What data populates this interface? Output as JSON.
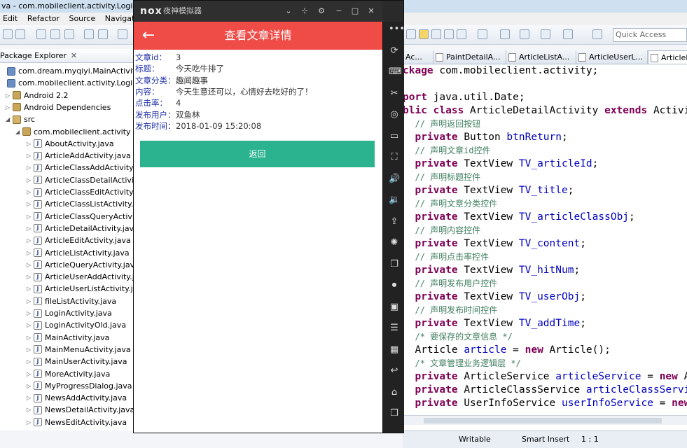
{
  "ide": {
    "window_title": "va - com.mobileclient.activity.LoginAct",
    "menu": [
      "Edit",
      "Refactor",
      "Source",
      "Navigate"
    ],
    "quick_access_placeholder": "Quick Access",
    "package_explorer": {
      "title": "Package Explorer",
      "items": [
        {
          "label": "com.dream.myqiyi.MainActivity",
          "kind": "proj"
        },
        {
          "label": "com.mobileclient.activity.LoginActiv",
          "kind": "proj"
        },
        {
          "label": "Android 2.2",
          "kind": "lib"
        },
        {
          "label": "Android Dependencies",
          "kind": "lib"
        },
        {
          "label": "src",
          "kind": "src"
        },
        {
          "label": "com.mobileclient.activity",
          "kind": "pkg"
        },
        {
          "label": "AboutActivity.java",
          "kind": "java"
        },
        {
          "label": "ArticleAddActivity.java",
          "kind": "java"
        },
        {
          "label": "ArticleClassAddActivity.ja",
          "kind": "java"
        },
        {
          "label": "ArticleClassDetailActivity.",
          "kind": "java"
        },
        {
          "label": "ArticleClassEditActivity.jav",
          "kind": "java"
        },
        {
          "label": "ArticleClassListActivity.jav",
          "kind": "java"
        },
        {
          "label": "ArticleClassQueryActivity.j",
          "kind": "java"
        },
        {
          "label": "ArticleDetailActivity.java",
          "kind": "java"
        },
        {
          "label": "ArticleEditActivity.java",
          "kind": "java"
        },
        {
          "label": "ArticleListActivity.java",
          "kind": "java"
        },
        {
          "label": "ArticleQueryActivity.java",
          "kind": "java"
        },
        {
          "label": "ArticleUserAddActivity.jav",
          "kind": "java"
        },
        {
          "label": "ArticleUserListActivity.jav",
          "kind": "java"
        },
        {
          "label": "fileListActivity.java",
          "kind": "java"
        },
        {
          "label": "LoginActivity.java",
          "kind": "java"
        },
        {
          "label": "LoginActivityOld.java",
          "kind": "java"
        },
        {
          "label": "MainActivity.java",
          "kind": "java"
        },
        {
          "label": "MainMenuActivity.java",
          "kind": "java"
        },
        {
          "label": "MainUserActivity.java",
          "kind": "java"
        },
        {
          "label": "MoreActivity.java",
          "kind": "java"
        },
        {
          "label": "MyProgressDialog.java",
          "kind": "java"
        },
        {
          "label": "NewsAddActivity.java",
          "kind": "java"
        },
        {
          "label": "NewsDetailActivity.java",
          "kind": "java"
        },
        {
          "label": "NewsEditActivity.java",
          "kind": "java"
        }
      ]
    },
    "editor_tabs": [
      "Ac...",
      "PaintDetailA...",
      "ArticleListA...",
      "ArticleUserL...",
      "ArticleD"
    ],
    "code_lines": [
      [
        {
          "t": "kw",
          "s": "ckage "
        },
        {
          "t": "",
          "s": "com.mobileclient.activity;"
        }
      ],
      [
        {
          "t": "",
          "s": ""
        }
      ],
      [
        {
          "t": "kw",
          "s": "port "
        },
        {
          "t": "",
          "s": "java.util.Date;"
        }
      ],
      [
        {
          "t": "kw",
          "s": "blic class "
        },
        {
          "t": "",
          "s": "ArticleDetailActivity "
        },
        {
          "t": "kw",
          "s": "extends "
        },
        {
          "t": "",
          "s": "Activit"
        }
      ],
      [
        {
          "t": "",
          "s": "  "
        },
        {
          "t": "cm",
          "s": "// 声明返回按钮"
        }
      ],
      [
        {
          "t": "",
          "s": "  "
        },
        {
          "t": "kw",
          "s": "private "
        },
        {
          "t": "",
          "s": "Button "
        },
        {
          "t": "fd",
          "s": "btnReturn"
        },
        {
          "t": "",
          "s": ";"
        }
      ],
      [
        {
          "t": "",
          "s": "  "
        },
        {
          "t": "cm",
          "s": "// 声明文章id控件"
        }
      ],
      [
        {
          "t": "",
          "s": "  "
        },
        {
          "t": "kw",
          "s": "private "
        },
        {
          "t": "",
          "s": "TextView "
        },
        {
          "t": "fd",
          "s": "TV_articleId"
        },
        {
          "t": "",
          "s": ";"
        }
      ],
      [
        {
          "t": "",
          "s": "  "
        },
        {
          "t": "cm",
          "s": "// 声明标题控件"
        }
      ],
      [
        {
          "t": "",
          "s": "  "
        },
        {
          "t": "kw",
          "s": "private "
        },
        {
          "t": "",
          "s": "TextView "
        },
        {
          "t": "fd",
          "s": "TV_title"
        },
        {
          "t": "",
          "s": ";"
        }
      ],
      [
        {
          "t": "",
          "s": "  "
        },
        {
          "t": "cm",
          "s": "// 声明文章分类控件"
        }
      ],
      [
        {
          "t": "",
          "s": "  "
        },
        {
          "t": "kw",
          "s": "private "
        },
        {
          "t": "",
          "s": "TextView "
        },
        {
          "t": "fd",
          "s": "TV_articleClassObj"
        },
        {
          "t": "",
          "s": ";"
        }
      ],
      [
        {
          "t": "",
          "s": "  "
        },
        {
          "t": "cm",
          "s": "// 声明内容控件"
        }
      ],
      [
        {
          "t": "",
          "s": "  "
        },
        {
          "t": "kw",
          "s": "private "
        },
        {
          "t": "",
          "s": "TextView "
        },
        {
          "t": "fd",
          "s": "TV_content"
        },
        {
          "t": "",
          "s": ";"
        }
      ],
      [
        {
          "t": "",
          "s": "  "
        },
        {
          "t": "cm",
          "s": "// 声明点击率控件"
        }
      ],
      [
        {
          "t": "",
          "s": "  "
        },
        {
          "t": "kw",
          "s": "private "
        },
        {
          "t": "",
          "s": "TextView "
        },
        {
          "t": "fd",
          "s": "TV_hitNum"
        },
        {
          "t": "",
          "s": ";"
        }
      ],
      [
        {
          "t": "",
          "s": "  "
        },
        {
          "t": "cm",
          "s": "// 声明发布用户控件"
        }
      ],
      [
        {
          "t": "",
          "s": "  "
        },
        {
          "t": "kw",
          "s": "private "
        },
        {
          "t": "",
          "s": "TextView "
        },
        {
          "t": "fd",
          "s": "TV_userObj"
        },
        {
          "t": "",
          "s": ";"
        }
      ],
      [
        {
          "t": "",
          "s": "  "
        },
        {
          "t": "cm",
          "s": "// 声明发布时间控件"
        }
      ],
      [
        {
          "t": "",
          "s": "  "
        },
        {
          "t": "kw",
          "s": "private "
        },
        {
          "t": "",
          "s": "TextView "
        },
        {
          "t": "fd",
          "s": "TV_addTime"
        },
        {
          "t": "",
          "s": ";"
        }
      ],
      [
        {
          "t": "",
          "s": "  "
        },
        {
          "t": "cm",
          "s": "/* 要保存的文章信息 */"
        }
      ],
      [
        {
          "t": "",
          "s": "  Article "
        },
        {
          "t": "fd",
          "s": "article"
        },
        {
          "t": "",
          "s": " = "
        },
        {
          "t": "kw",
          "s": "new "
        },
        {
          "t": "",
          "s": "Article();"
        }
      ],
      [
        {
          "t": "",
          "s": "  "
        },
        {
          "t": "cm",
          "s": "/* 文章管理业务逻辑层 */"
        }
      ],
      [
        {
          "t": "",
          "s": "  "
        },
        {
          "t": "kw",
          "s": "private "
        },
        {
          "t": "",
          "s": "ArticleService "
        },
        {
          "t": "fd",
          "s": "articleService"
        },
        {
          "t": "",
          "s": " = "
        },
        {
          "t": "kw",
          "s": "new "
        },
        {
          "t": "",
          "s": "Ar"
        }
      ],
      [
        {
          "t": "",
          "s": "  "
        },
        {
          "t": "kw",
          "s": "private "
        },
        {
          "t": "",
          "s": "ArticleClassService "
        },
        {
          "t": "fd",
          "s": "articleClassServic"
        }
      ],
      [
        {
          "t": "",
          "s": "  "
        },
        {
          "t": "kw",
          "s": "private "
        },
        {
          "t": "",
          "s": "UserInfoService "
        },
        {
          "t": "fd",
          "s": "userInfoService"
        },
        {
          "t": "",
          "s": " = "
        },
        {
          "t": "kw",
          "s": "new"
        }
      ]
    ],
    "status": {
      "writable": "Writable",
      "insert_mode": "Smart Insert",
      "position": "1 : 1"
    }
  },
  "emulator": {
    "logo": "nox",
    "name": "夜神模拟器",
    "app": {
      "title": "查看文章详情",
      "fields": [
        {
          "label": "文章id：",
          "value": "3"
        },
        {
          "label": "标题：",
          "value": "今天吃牛排了"
        },
        {
          "label": "文章分类：",
          "value": "趣闻趣事"
        },
        {
          "label": "内容：",
          "value": "今天生意还可以，心情好去吃好的了！"
        },
        {
          "label": "点击率：",
          "value": "4"
        },
        {
          "label": "发布用户：",
          "value": "双鱼林"
        },
        {
          "label": "发布时间：",
          "value": "2018-01-09 15:20:08"
        }
      ],
      "return_button": "返回"
    },
    "side_icons": [
      "more-icon",
      "phone-rotate-icon",
      "keyboard-icon",
      "scissors-icon",
      "location-icon",
      "screen-icon",
      "fullscreen-icon",
      "volume-up-icon",
      "volume-down-icon",
      "install-apk-icon",
      "loading-icon",
      "multi-instance-icon",
      "record-icon",
      "camera-icon",
      "menu-icon",
      "apps-icon",
      "back-icon",
      "home-icon",
      "recent-icon"
    ]
  }
}
